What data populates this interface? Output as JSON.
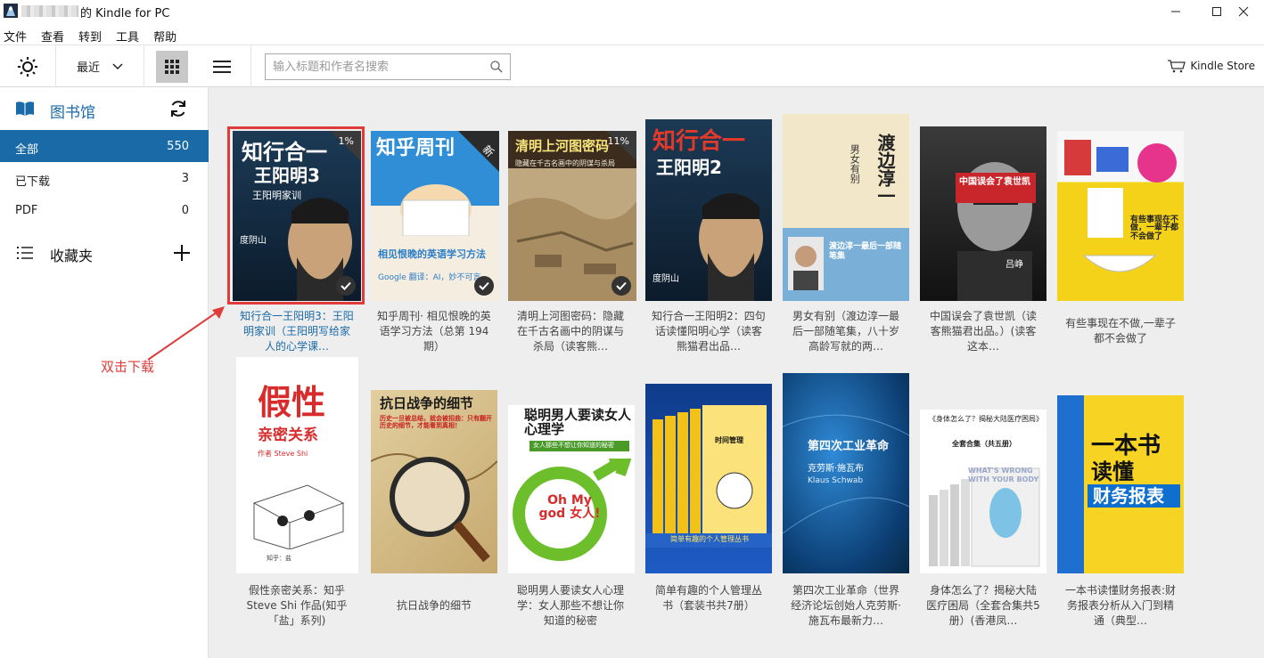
{
  "window": {
    "title": "的 Kindle for PC"
  },
  "menu": [
    "文件",
    "查看",
    "转到",
    "工具",
    "帮助"
  ],
  "toolbar": {
    "sort_label": "最近",
    "search_placeholder": "输入标题和作者名搜索",
    "store_label": "Kindle Store"
  },
  "sidebar": {
    "library_title": "图书馆",
    "items": [
      {
        "label": "全部",
        "count": "550",
        "active": true
      },
      {
        "label": "已下载",
        "count": "3",
        "active": false
      },
      {
        "label": "PDF",
        "count": "0",
        "active": false
      }
    ],
    "collections_title": "收藏夹"
  },
  "annotation": {
    "text": "双击下载",
    "color": "#e03b3b"
  },
  "books": [
    {
      "caption": "知行合一王阳明3：王阳明家训（王阳明写给家人的心学课…",
      "cover_title": "知行合一",
      "cover_sub": "王阳明3",
      "cover_line": "王阳明家训",
      "author": "度阴山",
      "progress": "1%",
      "downloaded": true,
      "selected": true
    },
    {
      "caption": "知乎周刊· 相见恨晚的英语学习方法（总第 194 期）",
      "cover_title": "知乎周刊",
      "cover_sub": "相见恨晚的英语学习方法",
      "cover_line": "Google 翻译：AI，妙不可言",
      "badge": "新",
      "downloaded": true
    },
    {
      "caption": "清明上河图密码：隐藏在千古名画中的阴谋与杀局（读客熊…",
      "cover_title": "清明上河图密码",
      "cover_sub": "隐藏在千古名画中的阴谋与杀局",
      "progress": "11%",
      "downloaded": true
    },
    {
      "caption": "知行合一王阳明2：四句话读懂阳明心学（读客熊猫君出品…",
      "cover_title": "知行合一",
      "cover_sub": "王阳明2",
      "author": "度阴山"
    },
    {
      "caption": "男女有别（渡边淳一最后一部随笔集，八十岁高龄写就的两…",
      "cover_title": "渡边淳一",
      "cover_sub": "渡边淳一最后一部随笔集",
      "cover_line": "男女有别"
    },
    {
      "caption": "中国误会了袁世凯（读客熊猫君出品。）(读客这本…",
      "cover_title": "中国误会了袁世凯",
      "author": "吕峥"
    },
    {
      "caption": "有些事现在不做,一辈子都不会做了",
      "cover_title": "有些事现在不做，一辈子都不会做了"
    },
    {
      "caption": "假性亲密关系：知乎 Steve Shi 作品(知乎「盐」系列)",
      "cover_title": "假性",
      "cover_sub": "亲密关系",
      "cover_line": "作者 Steve Shi",
      "author": "知乎：盐"
    },
    {
      "caption": "抗日战争的细节",
      "cover_title": "抗日战争的细节",
      "cover_sub": "历史一旦被总结，就会被招曲：只有翻开历史的细节，才能看到真相！"
    },
    {
      "caption": "聪明男人要读女人心理学：女人那些不想让你知道的秘密",
      "cover_title": "聪明男人要读女人心理学",
      "cover_sub": "女人那些不想让你知道的秘密",
      "cover_line": "Oh My god 女人!"
    },
    {
      "caption": "简单有趣的个人管理丛书（套装书共7册）",
      "cover_title": "时间管理",
      "cover_sub": "简单有趣的个人管理丛书"
    },
    {
      "caption": "第四次工业革命（世界经济论坛创始人克劳斯·施瓦布最新力…",
      "cover_title": "第四次工业革命",
      "cover_sub": "克劳斯·施瓦布",
      "cover_line": "Klaus Schwab"
    },
    {
      "caption": "身体怎么了？揭秘大陆医疗困局（全套合集共5册）(香港凤…",
      "cover_title": "《身体怎么了？揭秘大陆医疗困局》",
      "cover_sub": "全套合集（共五册）",
      "cover_line": "WHAT'S WRONG WITH YOUR BODY"
    },
    {
      "caption": "一本书读懂财务报表:财务报表分析从入门到精通（典型…",
      "cover_title": "一本书",
      "cover_sub": "读懂",
      "cover_line": "财务报表"
    }
  ]
}
